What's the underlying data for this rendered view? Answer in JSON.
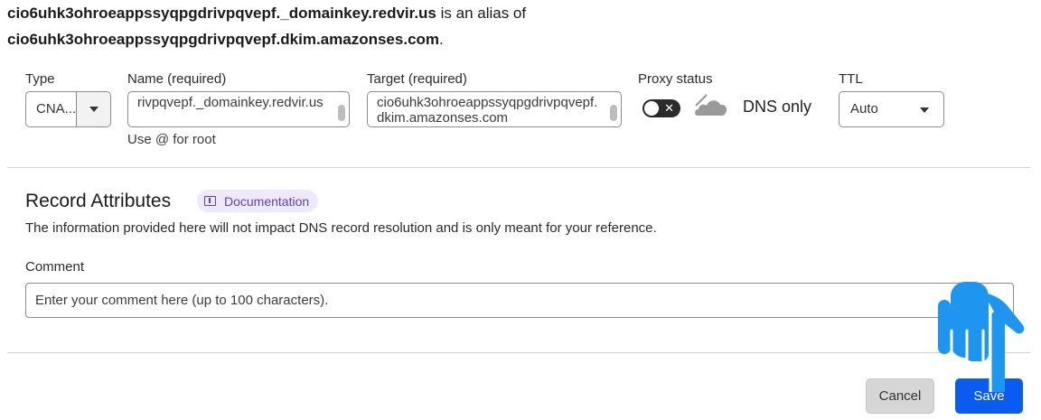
{
  "alias": {
    "name_bold": "cio6uhk3ohroeappssyqpgdrivpqvepf._domainkey.redvir.us",
    "middle_text": " is an alias of",
    "target_bold": "cio6uhk3ohroeappssyqpgdrivpqvepf.dkim.amazonses.com",
    "target_end": "."
  },
  "fields": {
    "type_label": "Type",
    "type_value": "CNA...",
    "name_label": "Name (required)",
    "name_value": "rivpqvepf._domainkey.redvir.us",
    "name_hint": "Use @ for root",
    "target_label": "Target (required)",
    "target_value": "cio6uhk3ohroeappssyqpgdrivpqvepf.dkim.amazonses.com",
    "proxy_label": "Proxy status",
    "proxy_toggle_mark": "✕",
    "proxy_value": "DNS only",
    "ttl_label": "TTL",
    "ttl_value": "Auto"
  },
  "record_attributes": {
    "title": "Record Attributes",
    "doc_badge": "Documentation",
    "description": "The information provided here will not impact DNS record resolution and is only meant for your reference.",
    "comment_label": "Comment",
    "comment_placeholder": "Enter your comment here (up to 100 characters).",
    "comment_value": ""
  },
  "actions": {
    "cancel_label": "Cancel",
    "save_label": "Save"
  },
  "colors": {
    "save_bg": "#0a5cf0",
    "badge_bg": "#efeafb",
    "badge_text": "#5b3fc2",
    "pointer_hand": "#1e96f0"
  }
}
